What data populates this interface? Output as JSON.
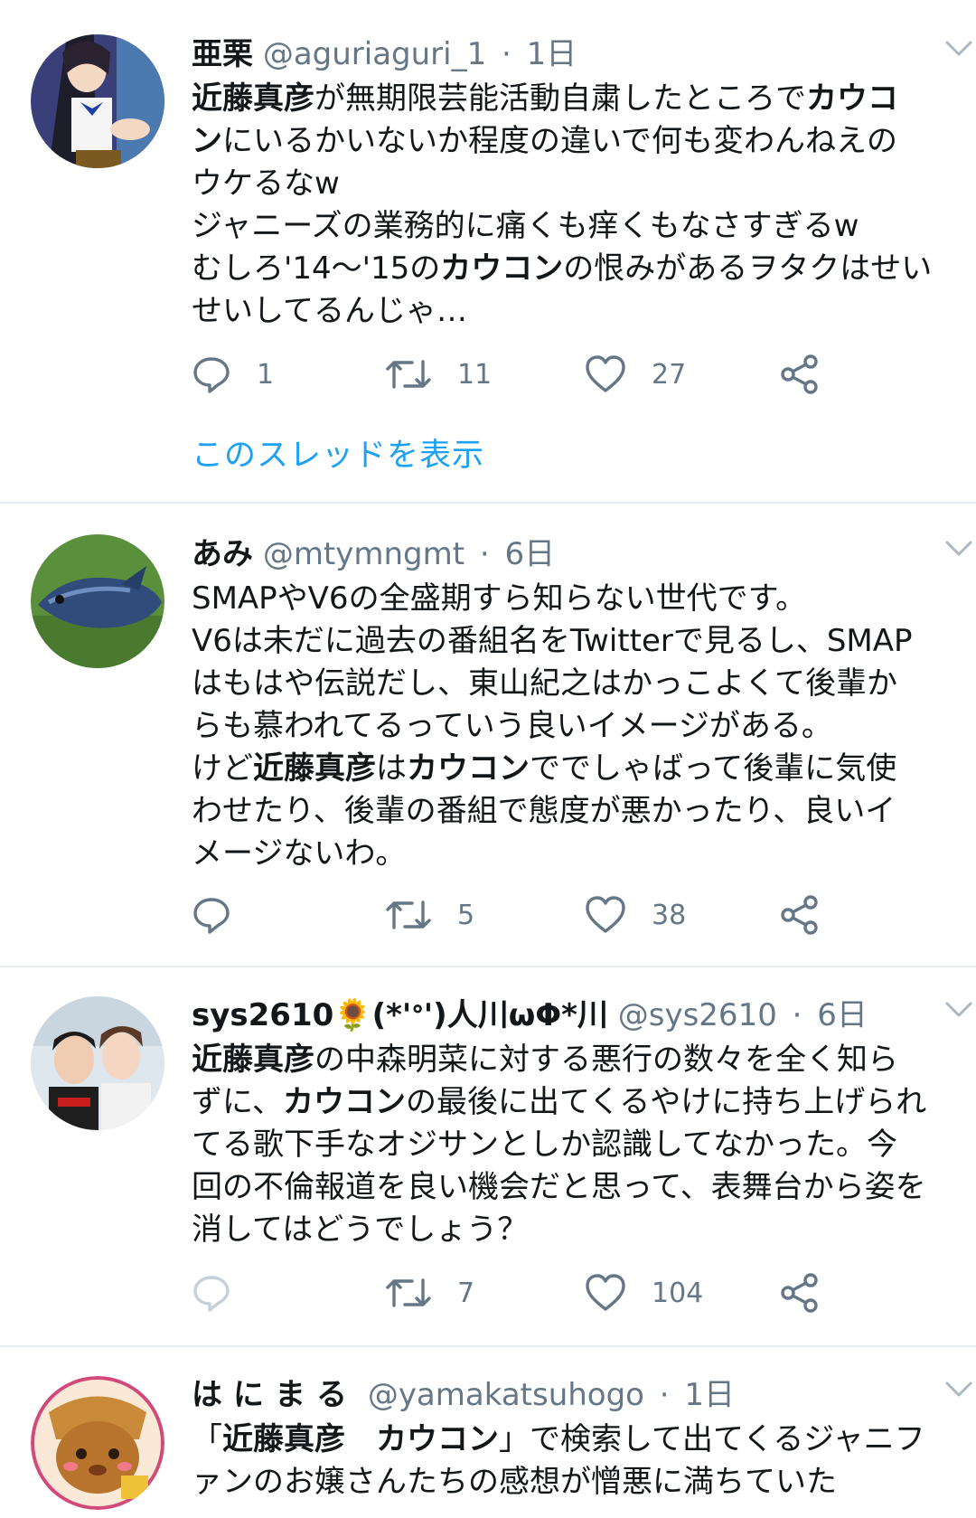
{
  "tweets": [
    {
      "name": "亜栗",
      "handle": "@aguriaguri_1",
      "time": "1日",
      "lines": [
        [
          {
            "t": "近藤真彦",
            "b": true
          },
          {
            "t": "が無期限芸能活動自粛したところで"
          },
          {
            "t": "カウコ",
            "b": true
          }
        ],
        [
          {
            "t": "ン",
            "b": true
          },
          {
            "t": "にいるかいないか程度の違いで何も変わんねえの"
          }
        ],
        [
          {
            "t": "ウケるなw"
          }
        ],
        [
          {
            "t": "ジャニーズの業務的に痛くも痒くもなさすぎるw"
          }
        ],
        [
          {
            "t": "むしろ'14〜'15の"
          },
          {
            "t": "カウコン",
            "b": true
          },
          {
            "t": "の恨みがあるヲタクはせい"
          }
        ],
        [
          {
            "t": "せいしてるんじゃ…"
          }
        ]
      ],
      "reply_count": "1",
      "retweet_count": "11",
      "like_count": "27",
      "thread_link": "このスレッドを表示"
    },
    {
      "name": "あみ",
      "handle": "@mtymngmt",
      "time": "6日",
      "lines": [
        [
          {
            "t": "SMAPやV6の全盛期すら知らない世代です。"
          }
        ],
        [
          {
            "t": "V6は未だに過去の番組名をTwitterで見るし、SMAP"
          }
        ],
        [
          {
            "t": "はもはや伝説だし、東山紀之はかっこよくて後輩か"
          }
        ],
        [
          {
            "t": "らも慕われてるっていう良いイメージがある。"
          }
        ],
        [
          {
            "t": "けど"
          },
          {
            "t": "近藤真彦",
            "b": true
          },
          {
            "t": "は"
          },
          {
            "t": "カウコン",
            "b": true
          },
          {
            "t": "ででしゃばって後輩に気使"
          }
        ],
        [
          {
            "t": "わせたり、後輩の番組で態度が悪かったり、良いイ"
          }
        ],
        [
          {
            "t": "メージないわ。"
          }
        ]
      ],
      "reply_count": "",
      "retweet_count": "5",
      "like_count": "38"
    },
    {
      "name": "sys2610🌻(*'ᐤ')人川ωΦ*川",
      "handle": "@sys2610",
      "time": "6日",
      "lines": [
        [
          {
            "t": "近藤真彦",
            "b": true
          },
          {
            "t": "の中森明菜に対する悪行の数々を全く知ら"
          }
        ],
        [
          {
            "t": "ずに、"
          },
          {
            "t": "カウコン",
            "b": true
          },
          {
            "t": "の最後に出てくるやけに持ち上げられ"
          }
        ],
        [
          {
            "t": "てる歌下手なオジサンとしか認識してなかった。今"
          }
        ],
        [
          {
            "t": "回の不倫報道を良い機会だと思って、表舞台から姿を"
          }
        ],
        [
          {
            "t": "消してはどうでしょう？"
          }
        ]
      ],
      "reply_count": "",
      "retweet_count": "7",
      "like_count": "104"
    },
    {
      "name": "はにまる",
      "handle": "@yamakatsuhogo",
      "time": "1日",
      "lines": [
        [
          {
            "t": "「"
          },
          {
            "t": "近藤真彦　カウコン",
            "b": true
          },
          {
            "t": "」で検索して出てくるジャニフ"
          }
        ],
        [
          {
            "t": "ァンのお嬢さんたちの感想が憎悪に満ちていた"
          }
        ]
      ]
    }
  ],
  "colors": {
    "text": "#14171a",
    "secondary": "#657786",
    "link": "#1da1f2",
    "divider": "#e6ecf0"
  },
  "icons": [
    "chevron-down-icon",
    "reply-icon",
    "retweet-icon",
    "like-icon",
    "share-icon"
  ]
}
